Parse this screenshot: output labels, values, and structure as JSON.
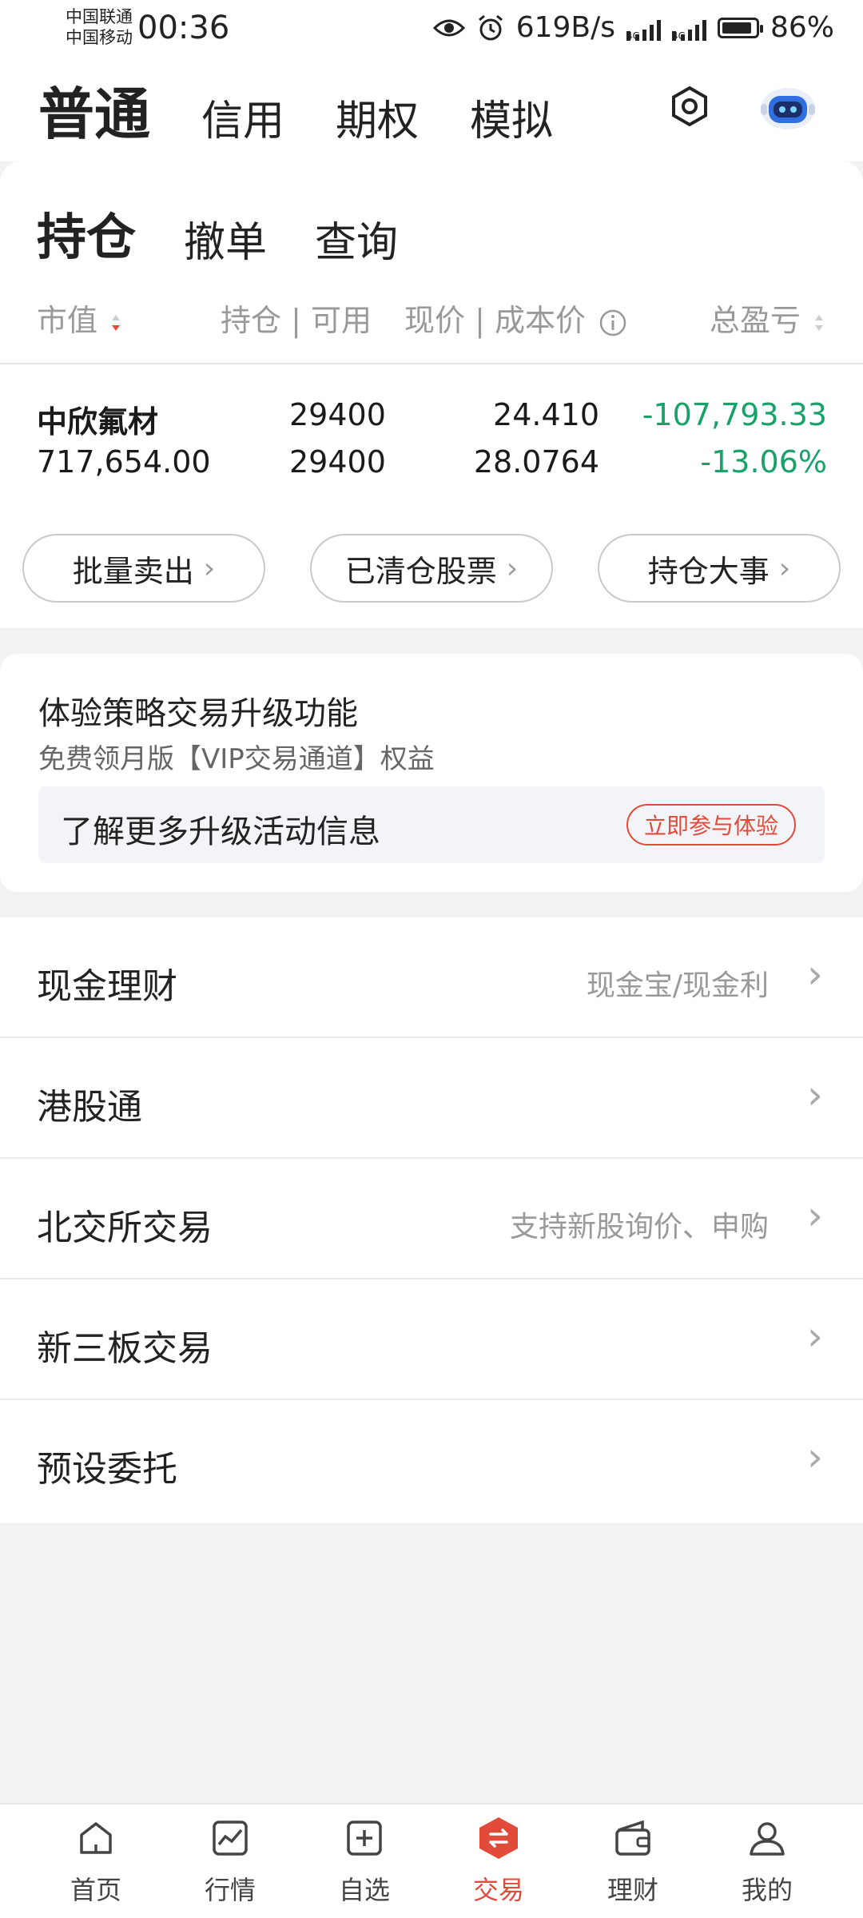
{
  "status_bar": {
    "carrier1": "中国联通",
    "carrier2": "中国移动",
    "time": "00:36",
    "net_speed": "619B/s",
    "signal_tag": "4G",
    "battery": "86%"
  },
  "top_tabs": [
    {
      "label": "普通",
      "active": true
    },
    {
      "label": "信用"
    },
    {
      "label": "期权"
    },
    {
      "label": "模拟"
    }
  ],
  "sub_tabs": [
    {
      "label": "持仓",
      "active": true
    },
    {
      "label": "撤单"
    },
    {
      "label": "查询"
    }
  ],
  "holdings_header": {
    "market_value": "市值",
    "position_available": "持仓 | 可用",
    "price_cost": "现价 | 成本价",
    "total_pl": "总盈亏"
  },
  "holdings": [
    {
      "name": "中欣氟材",
      "market_value": "717,654.00",
      "position": "29400",
      "available": "29400",
      "price": "24.410",
      "cost": "28.0764",
      "pl": "-107,793.33",
      "pl_pct": "-13.06%"
    }
  ],
  "action_pills": [
    {
      "label": "批量卖出"
    },
    {
      "label": "已清仓股票"
    },
    {
      "label": "持仓大事"
    }
  ],
  "promo": {
    "title": "体验策略交易升级功能",
    "subtitle": "免费领月版【VIP交易通道】权益",
    "box_text": "了解更多升级活动信息",
    "button": "立即参与体验"
  },
  "menu_list": [
    {
      "label": "现金理财",
      "desc": "现金宝/现金利"
    },
    {
      "label": "港股通",
      "desc": ""
    },
    {
      "label": "北交所交易",
      "desc": "支持新股询价、申购"
    },
    {
      "label": "新三板交易",
      "desc": ""
    },
    {
      "label": "预设委托",
      "desc": ""
    }
  ],
  "bottom_nav": [
    {
      "label": "首页",
      "icon": "home-icon"
    },
    {
      "label": "行情",
      "icon": "chart-icon"
    },
    {
      "label": "自选",
      "icon": "add-box-icon"
    },
    {
      "label": "交易",
      "icon": "trade-icon",
      "active": true
    },
    {
      "label": "理财",
      "icon": "wallet-icon"
    },
    {
      "label": "我的",
      "icon": "user-icon"
    }
  ],
  "colors": {
    "accent": "#e24a3a",
    "loss_green": "#18a26a",
    "muted": "#999999"
  }
}
